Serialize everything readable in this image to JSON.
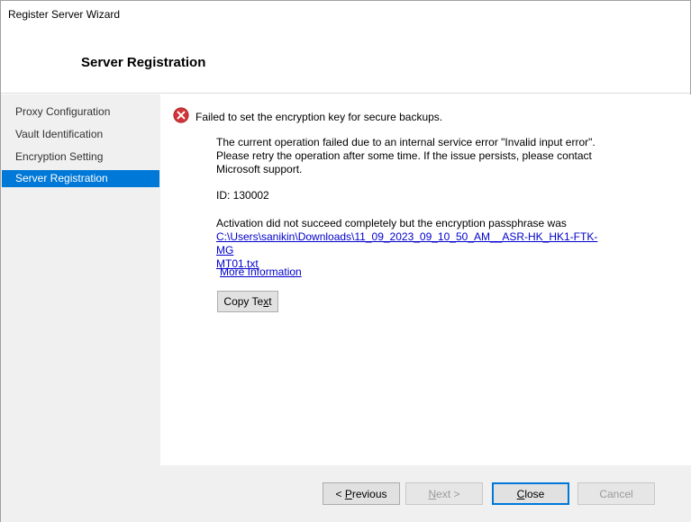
{
  "window": {
    "title": "Register Server Wizard"
  },
  "header": {
    "title": "Server Registration"
  },
  "sidebar": {
    "items": [
      {
        "label": "Proxy Configuration"
      },
      {
        "label": "Vault Identification"
      },
      {
        "label": "Encryption Setting"
      },
      {
        "label": "Server Registration",
        "selected": true
      }
    ]
  },
  "error": {
    "title": "Failed to set the encryption key for secure backups.",
    "description": [
      "The current operation failed due to an internal service error \"Invalid input error\".",
      "Please retry the operation after some time. If the issue persists, please contact",
      "Microsoft support."
    ],
    "id_text": "ID: 130002",
    "activation_text": "Activation did not succeed completely but the encryption passphrase was",
    "path_line1": "C:\\Users\\sanikin\\Downloads\\11_09_2023_09_10_50_AM__ASR-HK_HK1-FTK-MG",
    "path_line2": "MT01.txt",
    "more_info": "More Information",
    "copy_button": {
      "pre": "Copy Te",
      "accel": "x",
      "post": "t"
    }
  },
  "footer": {
    "previous": {
      "pre": "< ",
      "accel": "P",
      "post": "revious"
    },
    "next": {
      "pre": "",
      "accel": "N",
      "post": "ext >"
    },
    "close": {
      "pre": "",
      "accel": "C",
      "post": "lose"
    },
    "cancel": "Cancel"
  },
  "colors": {
    "accent": "#0078d7",
    "error_red": "#d13438",
    "link": "#0000cc"
  }
}
